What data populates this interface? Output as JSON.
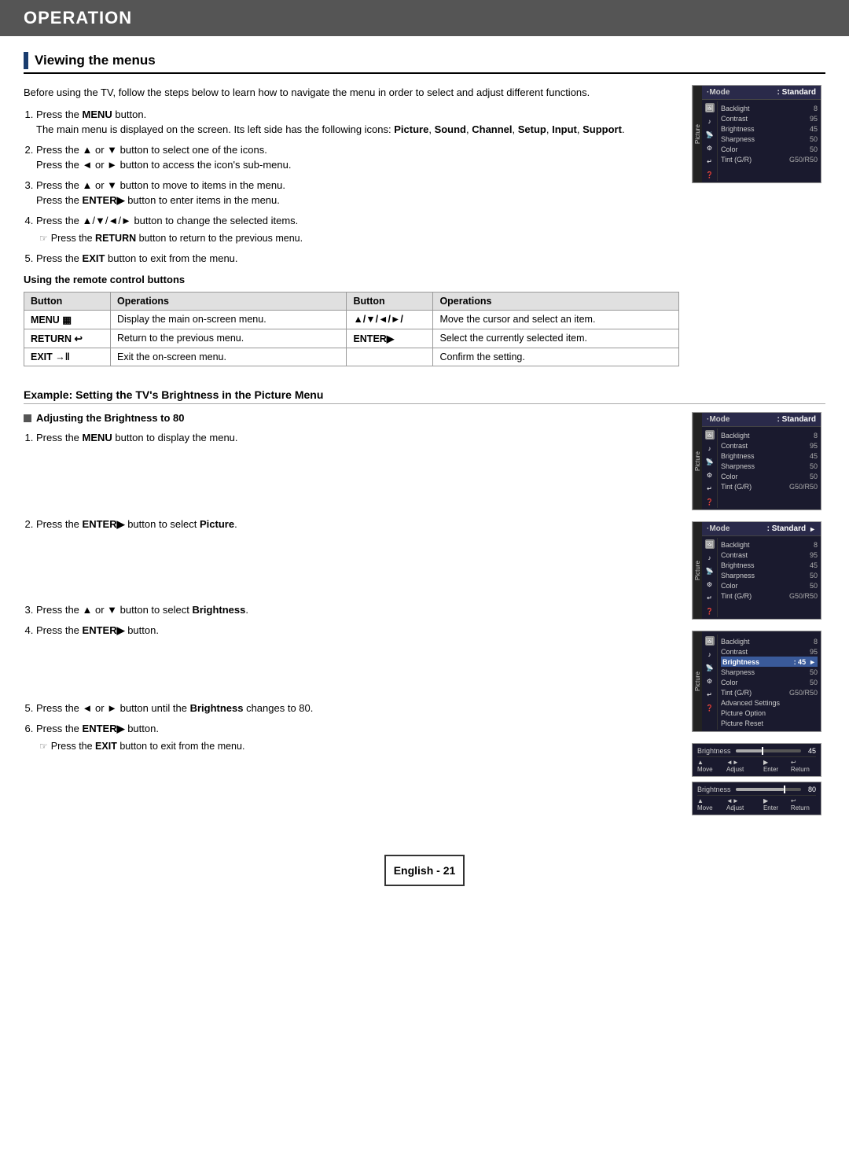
{
  "page": {
    "title": "OPERATION",
    "section": "Viewing the menus",
    "intro": "Before using the TV, follow the steps below to learn how to navigate the menu in order to select and adjust different functions.",
    "steps": [
      {
        "num": 1,
        "main": "Press the MENU button.",
        "sub": "The main menu is displayed on the screen. Its left side has the following icons: Picture, Sound, Channel, Setup, Input, Support.",
        "bold_words": [
          "MENU",
          "Picture,",
          "Sound,",
          "Channel,",
          "Setup,",
          "Input,",
          "Support."
        ]
      },
      {
        "num": 2,
        "main": "Press the ▲ or ▼ button to select one of the icons.",
        "sub": "Press the ◄ or ► button to access the icon's sub-menu."
      },
      {
        "num": 3,
        "main": "Press the ▲ or ▼ button to move to items in the menu.",
        "sub": "Press the ENTER▶ button to enter items in the menu.",
        "bold_sub": "ENTER"
      },
      {
        "num": 4,
        "main": "Press the ▲/▼/◄/► button to change the selected items.",
        "note": "Press the RETURN button to return to the previous menu.",
        "note_bold": "RETURN"
      },
      {
        "num": 5,
        "main": "Press the EXIT button to exit from the menu.",
        "bold": "EXIT"
      }
    ],
    "using_remote_label": "Using the remote control buttons",
    "table": {
      "headers": [
        "Button",
        "Operations",
        "Button",
        "Operations"
      ],
      "rows": [
        {
          "btn1": "MENU ▦",
          "ops1": "Display the main on-screen menu.",
          "btn2": "▲/▼/◄/►/",
          "ops2": "Move the cursor and select an item."
        },
        {
          "btn1": "RETURN ↩",
          "ops1": "Return to the previous menu.",
          "btn2": "ENTER▶",
          "ops2": "Select the currently selected item."
        },
        {
          "btn1": "EXIT →‖",
          "ops1": "Exit the on-screen menu.",
          "btn2": "",
          "ops2": "Confirm the setting."
        }
      ]
    },
    "example_section": {
      "title": "Example: Setting the TV's Brightness in the Picture Menu",
      "adjusting_title": "Adjusting the Brightness to 80",
      "steps": [
        {
          "num": 1,
          "main": "Press the MENU button to display the menu.",
          "bold": "MENU"
        },
        {
          "num": 2,
          "main": "Press the ENTER▶ button to select Picture.",
          "bold": "ENTER▶",
          "bold2": "Picture"
        },
        {
          "num": 3,
          "main": "Press the ▲ or ▼ button to select Brightness.",
          "bold": "Brightness"
        },
        {
          "num": 4,
          "main": "Press the ENTER▶ button.",
          "bold": "ENTER▶"
        },
        {
          "num": 5,
          "main": "Press the ◄ or ► button until the Brightness changes to 80.",
          "bold": "Brightness"
        },
        {
          "num": 6,
          "main": "Press the ENTER▶ button.",
          "bold": "ENTER▶",
          "note": "Press the EXIT button to exit from the menu.",
          "note_bold": "EXIT"
        }
      ]
    },
    "menus": {
      "menu1": {
        "side_label": "Picture",
        "mode_label": "·Mode",
        "mode_value": ": Standard",
        "items": [
          {
            "name": "Backlight",
            "value": "8",
            "highlighted": false
          },
          {
            "name": "Contrast",
            "value": "95",
            "highlighted": false
          },
          {
            "name": "Brightness",
            "value": "45",
            "highlighted": false
          },
          {
            "name": "Sharpness",
            "value": "50",
            "highlighted": false
          },
          {
            "name": "Color",
            "value": "50",
            "highlighted": false
          },
          {
            "name": "Tint (G/R)",
            "value": "G50/R50",
            "highlighted": false
          }
        ]
      },
      "menu2": {
        "side_label": "Picture",
        "mode_label": "·Mode",
        "mode_value": ": Standard",
        "mode_arrow": "►",
        "items": [
          {
            "name": "Backlight",
            "value": "8",
            "highlighted": false
          },
          {
            "name": "Contrast",
            "value": "95",
            "highlighted": false
          },
          {
            "name": "Brightness",
            "value": "45",
            "highlighted": false
          },
          {
            "name": "Sharpness",
            "value": "50",
            "highlighted": false
          },
          {
            "name": "Color",
            "value": "50",
            "highlighted": false
          },
          {
            "name": "Tint (G/R)",
            "value": "G50/R50",
            "highlighted": false
          }
        ]
      },
      "menu3": {
        "side_label": "Picture",
        "mode_label": "·Mode",
        "mode_value": ": Standard",
        "mode_arrow": "►",
        "items": [
          {
            "name": "Backlight",
            "value": "8",
            "highlighted": false
          },
          {
            "name": "Contrast",
            "value": "95",
            "highlighted": false
          },
          {
            "name": "Brightness",
            "value": "45",
            "highlighted": false
          },
          {
            "name": "Sharpness",
            "value": "50",
            "highlighted": false
          },
          {
            "name": "Color",
            "value": "50",
            "highlighted": false
          },
          {
            "name": "Tint (G/R)",
            "value": "G50/R50",
            "highlighted": false
          }
        ]
      },
      "menu4": {
        "side_label": "Picture",
        "mode_label": "",
        "mode_value": "",
        "items": [
          {
            "name": "Backlight",
            "value": "8",
            "highlighted": false
          },
          {
            "name": "Contrast",
            "value": "95",
            "highlighted": false
          },
          {
            "name": "Brightness",
            "value": "45",
            "highlighted": true
          },
          {
            "name": "Sharpness",
            "value": "50",
            "highlighted": false
          },
          {
            "name": "Color",
            "value": "50",
            "highlighted": false
          },
          {
            "name": "Tint (G/R)",
            "value": "G50/R50",
            "highlighted": false
          },
          {
            "name": "Advanced Settings",
            "value": "",
            "highlighted": false
          },
          {
            "name": "Picture Option",
            "value": "",
            "highlighted": false
          },
          {
            "name": "Picture Reset",
            "value": "",
            "highlighted": false
          }
        ]
      }
    },
    "sliders": {
      "slider1": {
        "label": "Brightness",
        "value": "45",
        "fill_pct": 40,
        "controls": "▲ Move  ◄► Adjust  ▶ Enter  ↩ Return"
      },
      "slider2": {
        "label": "Brightness",
        "value": "80",
        "fill_pct": 73,
        "controls": "▲ Move  ◄► Adjust  ▶ Enter  ↩ Return"
      }
    },
    "footer": {
      "label": "English - 21"
    }
  }
}
